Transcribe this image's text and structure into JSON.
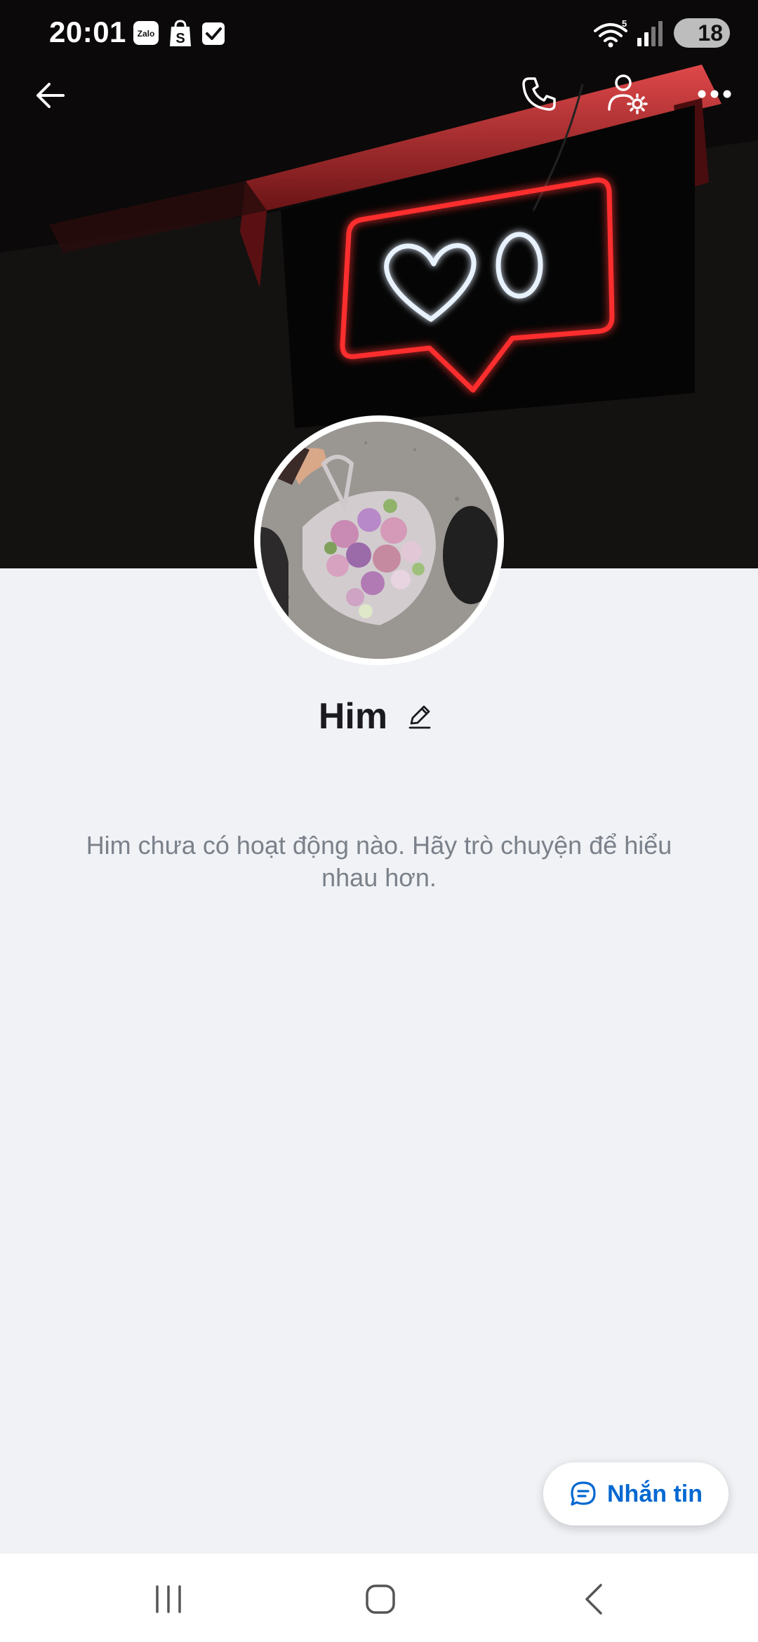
{
  "status_bar": {
    "time": "20:01",
    "app_icons": [
      "zalo-icon",
      "shopee-icon",
      "checkbox-icon"
    ],
    "zalo_label": "Zalo",
    "battery_level": "18",
    "wifi_badge": "5"
  },
  "top_bar": {
    "back_icon": "arrow-left-icon",
    "call_icon": "phone-icon",
    "settings_icon": "user-settings-icon",
    "more_icon": "more-horizontal-icon"
  },
  "profile": {
    "name": "Him",
    "edit_icon": "pencil-icon"
  },
  "empty_state": {
    "message": "Him chưa có hoạt động nào. Hãy trò chuyện để hiểu nhau hơn."
  },
  "message_button": {
    "label": "Nhắn tin",
    "icon": "chat-bubble-icon"
  },
  "nav_bar": {
    "recents_icon": "recent-apps-icon",
    "home_icon": "home-icon",
    "back_icon": "back-chevron-icon"
  },
  "colors": {
    "accent": "#0068d1",
    "background": "#f0f2f5",
    "name_text": "#1b1b1f",
    "muted_text": "#7b818a"
  }
}
